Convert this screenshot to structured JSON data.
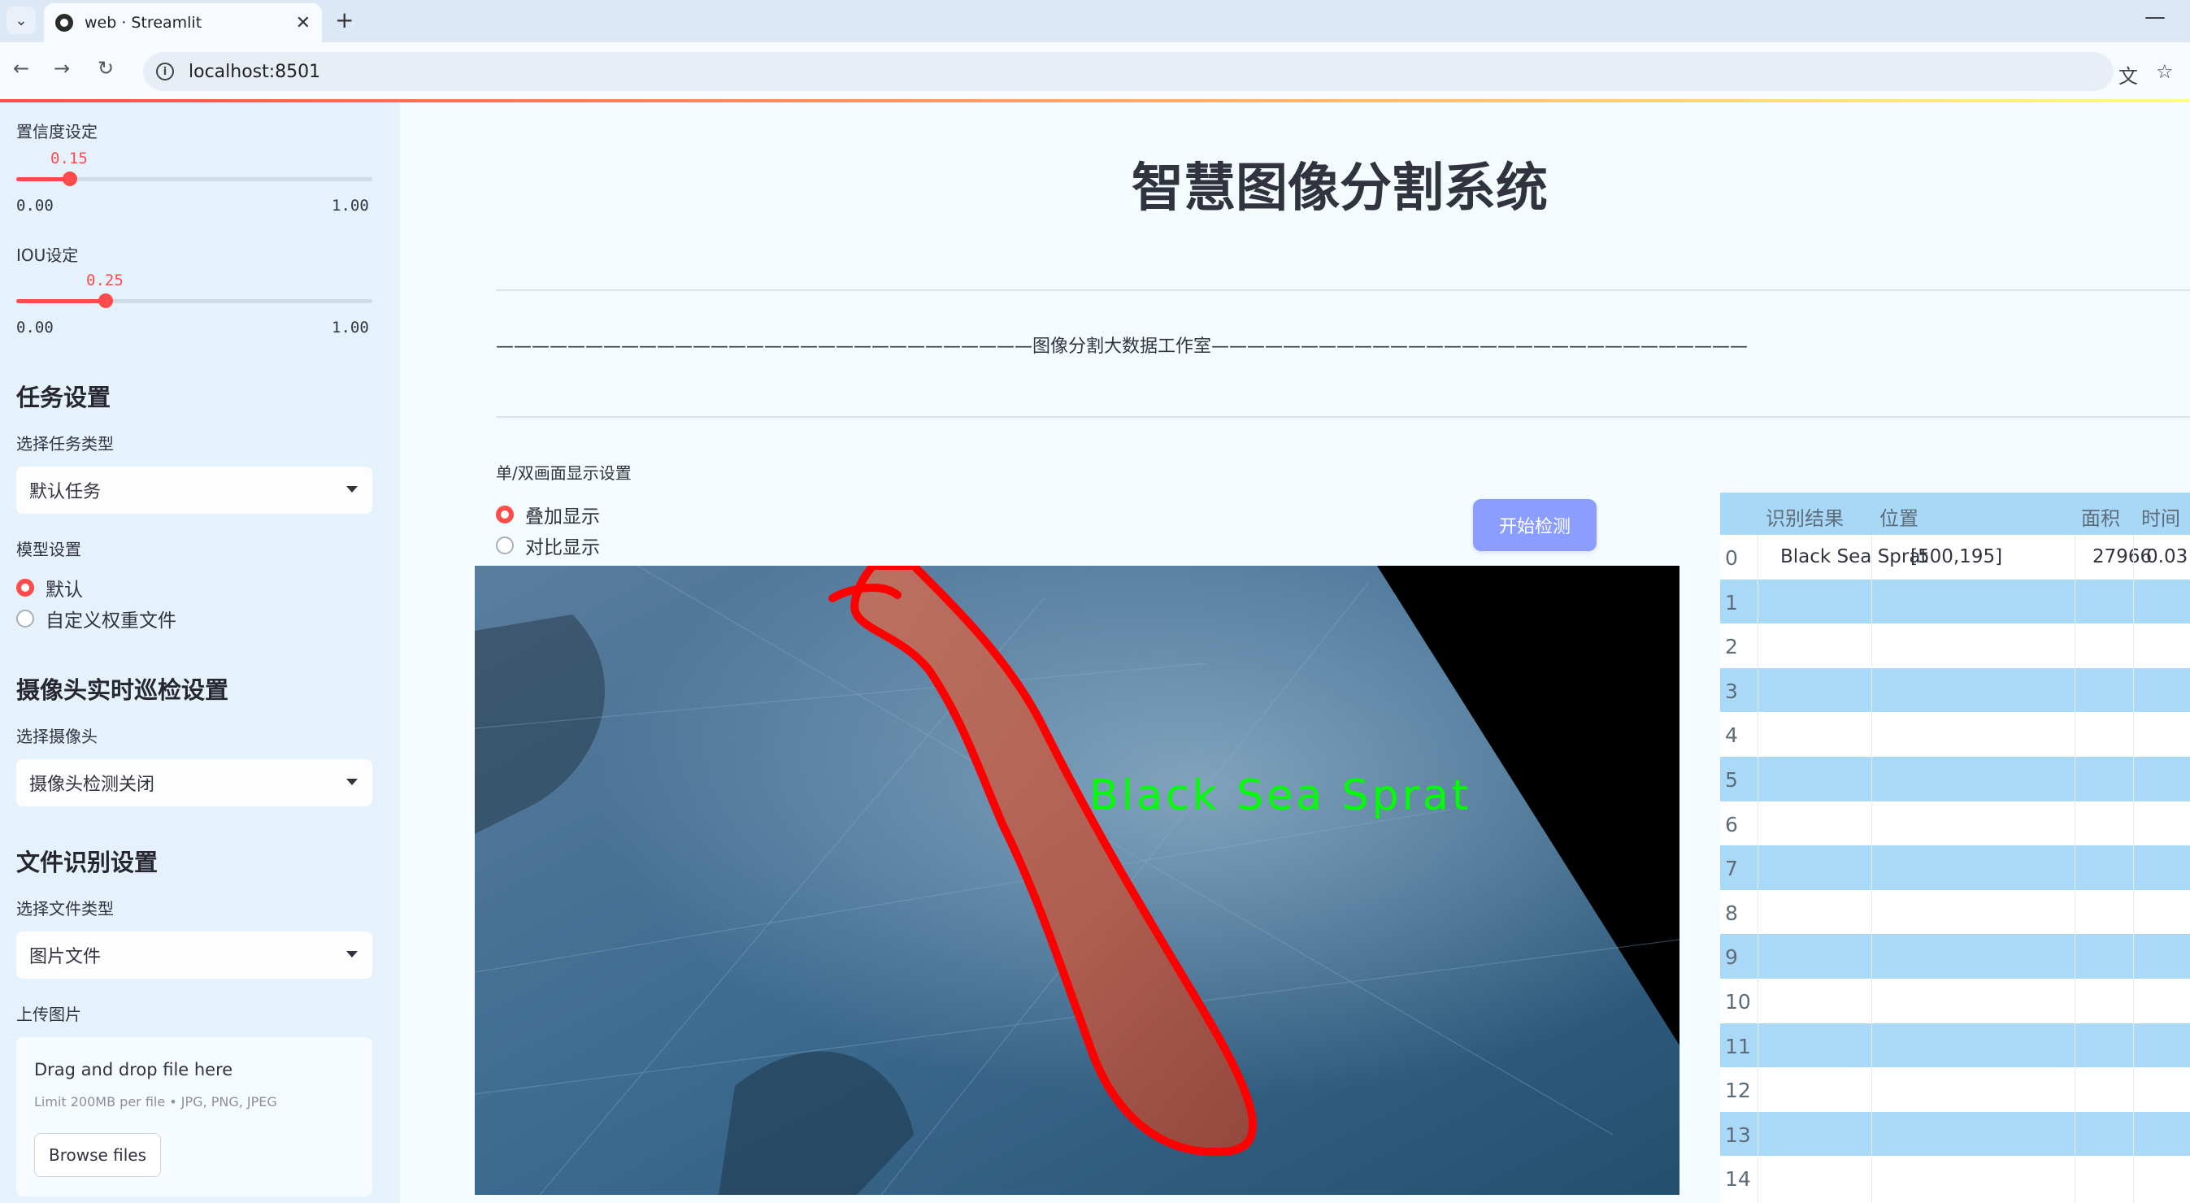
{
  "browser": {
    "tab_title": "web · Streamlit",
    "url": "localhost:8501"
  },
  "sidebar": {
    "confidence": {
      "label": "置信度设定",
      "value": "0.15",
      "fraction": 0.15,
      "min": "0.00",
      "max": "1.00"
    },
    "iou": {
      "label": "IOU设定",
      "value": "0.25",
      "fraction": 0.25,
      "min": "0.00",
      "max": "1.00"
    },
    "task_section": {
      "heading": "任务设置",
      "select_label": "选择任务类型",
      "selected": "默认任务"
    },
    "model_section": {
      "label": "模型设置",
      "options": [
        "默认",
        "自定义权重文件"
      ],
      "selected_index": 0
    },
    "camera_section": {
      "heading": "摄像头实时巡检设置",
      "select_label": "选择摄像头",
      "selected": "摄像头检测关闭"
    },
    "file_section": {
      "heading": "文件识别设置",
      "select_label": "选择文件类型",
      "selected": "图片文件"
    },
    "upload": {
      "label": "上传图片",
      "title": "Drag and drop file here",
      "subtitle": "Limit 200MB per file • JPG, PNG, JPEG",
      "button": "Browse files"
    }
  },
  "main": {
    "title": "智慧图像分割系统",
    "studio_line": "——————————————————————————————图像分割大数据工作室——————————————————————————————",
    "display_label": "单/双画面显示设置",
    "display_options": [
      "叠加显示",
      "对比显示"
    ],
    "display_selected_index": 0,
    "start_button": "开始检测",
    "detection_label": "Black Sea Sprat"
  },
  "table": {
    "headers": [
      "识别结果",
      "位置",
      "面积",
      "时间"
    ],
    "row_indices": [
      "0",
      "1",
      "2",
      "3",
      "4",
      "5",
      "6",
      "7",
      "8",
      "9",
      "10",
      "11",
      "12",
      "13",
      "14"
    ],
    "first_row": {
      "result": "Black Sea Sprat",
      "position": "[500,195]",
      "area": "27966",
      "time": "0.03"
    }
  },
  "colors": {
    "accent": "#ff4b4b",
    "button": "#8b9dff",
    "sidebar_bg": "#e6f2fb",
    "table_stripe": "#aad9f7",
    "mask_outline": "#ff0000",
    "label_text": "#00ff00"
  }
}
